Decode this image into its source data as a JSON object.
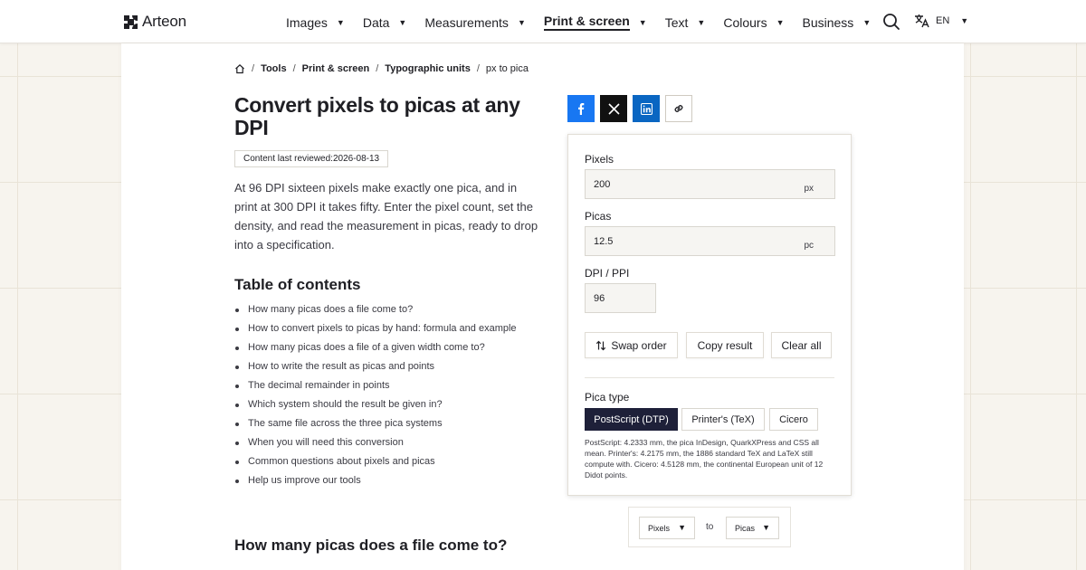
{
  "brand": {
    "name": "Arteon"
  },
  "nav": {
    "items": [
      {
        "label": "Images"
      },
      {
        "label": "Data"
      },
      {
        "label": "Measurements"
      },
      {
        "label": "Print & screen"
      },
      {
        "label": "Text"
      },
      {
        "label": "Colours"
      },
      {
        "label": "Business"
      }
    ],
    "active_index": 3,
    "language": "EN"
  },
  "breadcrumb": {
    "items": [
      "Tools",
      "Print & screen",
      "Typographic units",
      "px to pica"
    ]
  },
  "page": {
    "title": "Convert pixels to picas at any DPI",
    "reviewed_label": "Content last reviewed:",
    "reviewed_date": "2026-08-13",
    "intro": "At 96 DPI sixteen pixels make exactly one pica, and in print at 300 DPI it takes fifty. Enter the pixel count, set the density, and read the measurement in picas, ready to drop into a specification.",
    "toc_title": "Table of contents",
    "toc": [
      "How many picas does a file come to?",
      "How to convert pixels to picas by hand: formula and example",
      "How many picas does a file of a given width come to?",
      "How to write the result as picas and points",
      "The decimal remainder in points",
      "Which system should the result be given in?",
      "The same file across the three pica systems",
      "When you will need this conversion",
      "Common questions about pixels and picas",
      "Help us improve our tools"
    ],
    "section_heading": "How many picas does a file come to?"
  },
  "converter": {
    "pixels_label": "Pixels",
    "pixels_value": "200",
    "pixels_unit": "px",
    "picas_label": "Picas",
    "picas_value": "12.5",
    "picas_unit": "pc",
    "dpi_label": "DPI / PPI",
    "dpi_value": "96",
    "swap_label": "Swap order",
    "copy_label": "Copy result",
    "clear_label": "Clear all",
    "pica_type_label": "Pica type",
    "pica_types": [
      "PostScript (DTP)",
      "Printer's (TeX)",
      "Cicero"
    ],
    "selected_pica_type": 0,
    "note": "PostScript: 4.2333 mm, the pica InDesign, QuarkXPress and CSS all mean. Printer's: 4.2175 mm, the 1886 standard TeX and LaTeX still compute with. Cicero: 4.5128 mm, the continental European unit of 12 Didot points."
  },
  "unit_switcher": {
    "from": "Pixels",
    "to_word": "to",
    "to": "Picas"
  },
  "colors": {
    "facebook": "#1877f2",
    "x": "#111111",
    "linkedin": "#0a66c2",
    "selected": "#1e2039"
  },
  "icons": [
    "search-icon",
    "translate-icon",
    "home-icon",
    "facebook-icon",
    "x-icon",
    "linkedin-icon",
    "link-icon",
    "swap-icon"
  ]
}
